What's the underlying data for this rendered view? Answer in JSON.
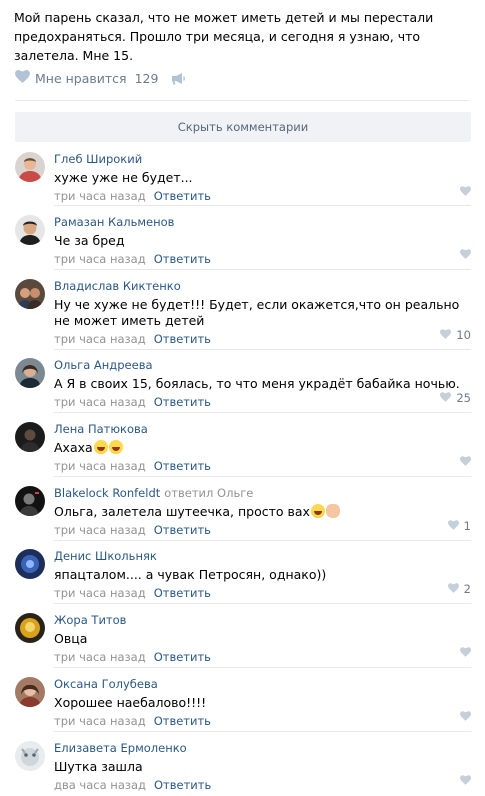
{
  "post": {
    "text": "Мой парень сказал, что не может иметь детей и мы перестали предохраняться. Прошло три месяца, и сегодня я узнаю, что залетела. Мне 15.",
    "like_label": "Мне нравится",
    "like_count": "129"
  },
  "hide_comments_label": "Скрыть комментарии",
  "reply_label": "Ответить",
  "comments": [
    {
      "author": "Глеб Широкий",
      "text": "хуже уже не будет...",
      "time": "три часа назад",
      "likes": ""
    },
    {
      "author": "Рамазан Кальменов",
      "text": "Че за бред",
      "time": "три часа назад",
      "likes": ""
    },
    {
      "author": "Владислав Киктенко",
      "text": "Ну че хуже не будет!!! Будет, если окажется,что он реально не может иметь детей",
      "time": "три часа назад",
      "likes": "10"
    },
    {
      "author": "Ольга Андреева",
      "text": "А Я в своих 15, боялась, то что меня украдёт бабайка ночью.",
      "time": "три часа назад",
      "likes": "25"
    },
    {
      "author": "Лена Патюкова",
      "text": "Ахаха",
      "time": "три часа назад",
      "likes": ""
    },
    {
      "author": "Blakelock Ronfeldt",
      "replied_word": "ответил",
      "replied_to": "Ольге",
      "text": "Ольга, залетела шутеечка, просто вах",
      "time": "три часа назад",
      "likes": "1"
    },
    {
      "author": "Денис Школьняк",
      "text": "япацталом.... а чувак Петросян, однако))",
      "time": "три часа назад",
      "likes": "2"
    },
    {
      "author": "Жора Титов",
      "text": "Овца",
      "time": "три часа назад",
      "likes": ""
    },
    {
      "author": "Оксана Голубева",
      "text": "Хорошее наебалово!!!!",
      "time": "три часа назад",
      "likes": ""
    },
    {
      "author": "Елизавета Ермоленко",
      "text": "Шутка зашла",
      "time": "два часа назад",
      "likes": ""
    }
  ],
  "colors": {
    "link": "#2a5885",
    "meta": "#939393",
    "like_icon": "#b3c3d6",
    "separator": "#e7e8ec"
  }
}
